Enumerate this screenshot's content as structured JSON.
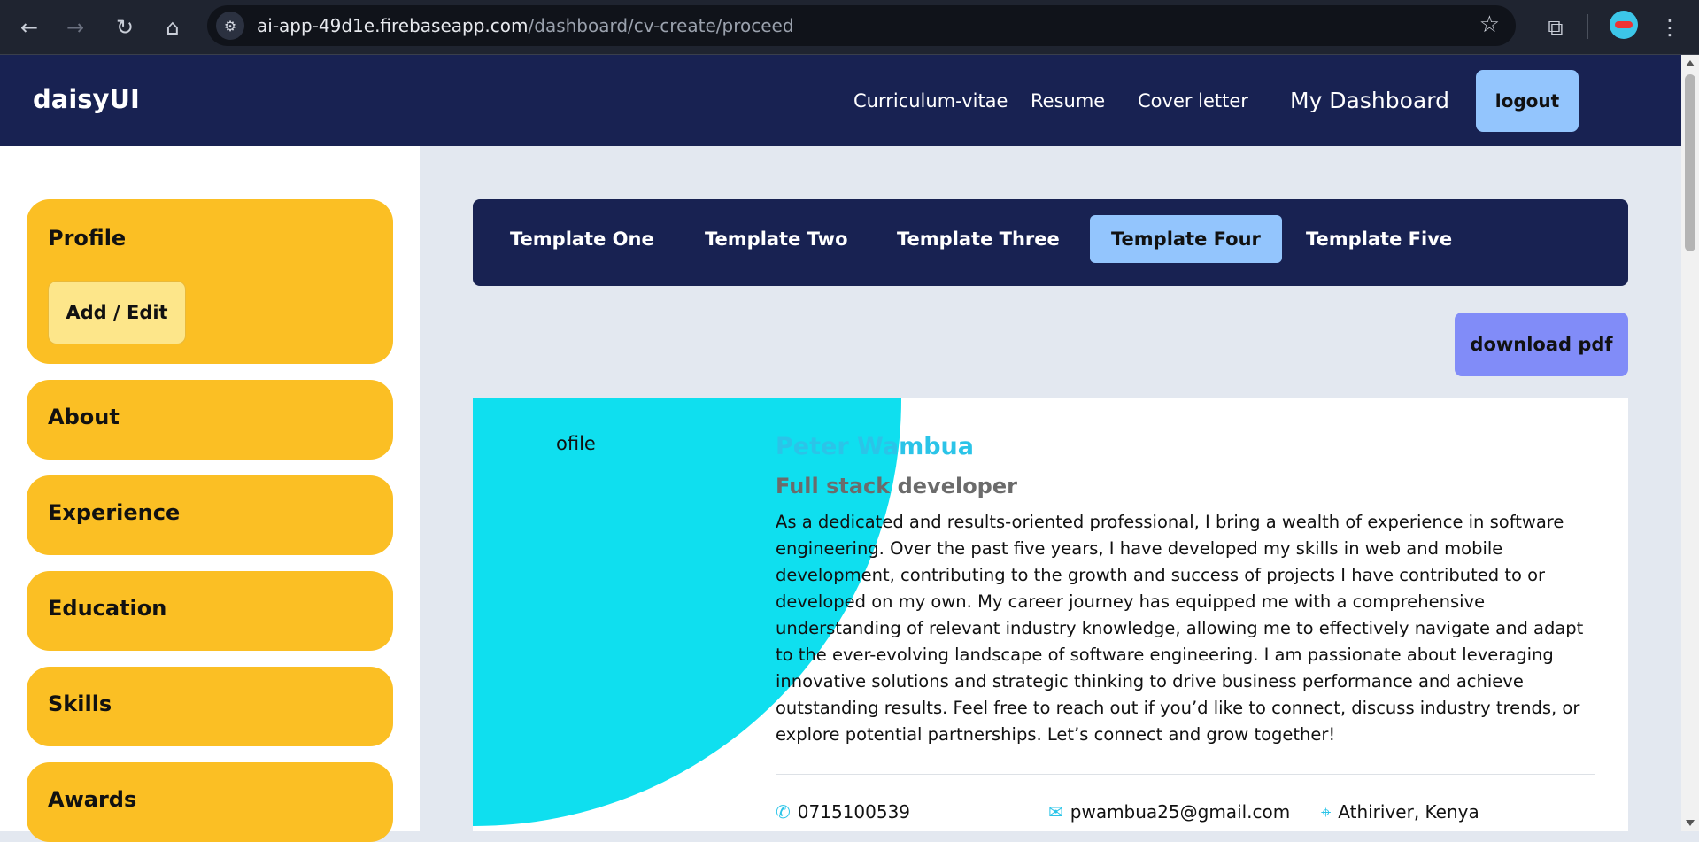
{
  "browser": {
    "url_domain": "ai-app-49d1e.firebaseapp.com",
    "url_path": "/dashboard/cv-create/proceed",
    "icons": {
      "back": "arrow-left-icon",
      "forward": "arrow-right-icon",
      "reload": "reload-icon",
      "home": "home-icon",
      "site_info": "tune-icon",
      "bookmark": "star-icon",
      "extensions": "puzzle-icon",
      "menu": "kebab-menu-icon"
    }
  },
  "navbar": {
    "brand": "daisyUI",
    "links": [
      "Curriculum-vitae",
      "Resume",
      "Cover letter"
    ],
    "dashboard": "My Dashboard",
    "logout": "logout"
  },
  "sidebar": {
    "profile_title": "Profile",
    "profile_button": "Add / Edit",
    "sections": [
      "About",
      "Experience",
      "Education",
      "Skills",
      "Awards"
    ]
  },
  "templates": {
    "tabs": [
      "Template One",
      "Template Two",
      "Template Three",
      "Template Four",
      "Template Five"
    ],
    "active": "Template Four"
  },
  "download_label": "download pdf",
  "cv": {
    "image_alt": "ofile",
    "name": "Peter Wambua",
    "role": "Full stack developer",
    "about": "As a dedicated and results-oriented professional, I bring a wealth of experience in software engineering. Over the past five years, I have developed my skills in web and mobile development, contributing to the growth and success of projects I have contributed to or developed on my own. My career journey has equipped me with a comprehensive understanding of relevant industry knowledge, allowing me to effectively navigate and adapt to the ever-evolving landscape of software engineering. I am passionate about leveraging innovative solutions and strategic thinking to drive business performance and achieve outstanding results. Feel free to reach out if you’d like to connect, discuss industry trends, or explore potential partnerships. Let’s connect and grow together!",
    "phone": "0715100539",
    "email": "pwambua25@gmail.com",
    "location": "Athiriver, Kenya"
  },
  "colors": {
    "navbar": "#182252",
    "card": "#fbbf24",
    "accent": "#93c5fd",
    "download": "#818cf8",
    "cyan": "#0fdfef"
  }
}
